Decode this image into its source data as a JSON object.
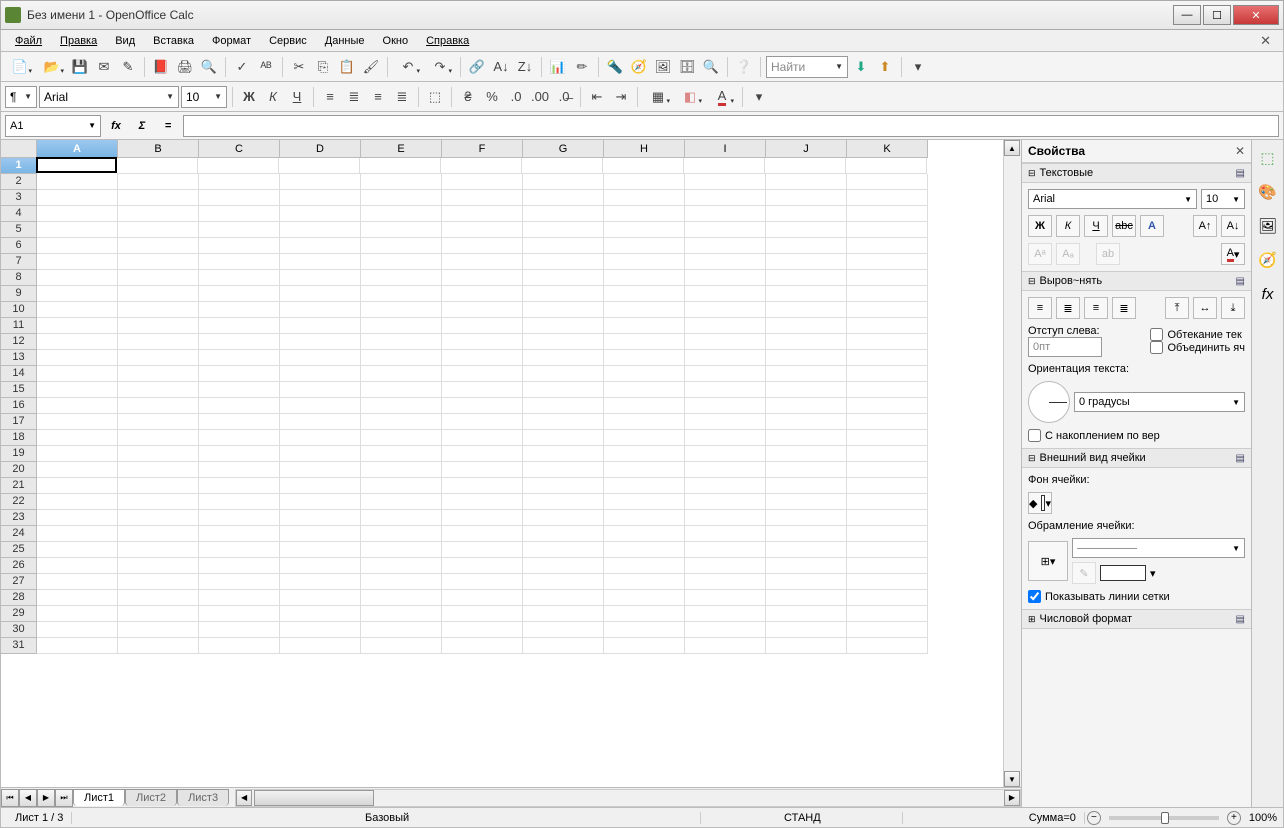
{
  "title": "Без имени 1 - OpenOffice Calc",
  "menu": [
    "Файл",
    "Правка",
    "Вид",
    "Вставка",
    "Формат",
    "Сервис",
    "Данные",
    "Окно",
    "Справка"
  ],
  "toolbar2": {
    "font": "Arial",
    "size": "10"
  },
  "find_placeholder": "Найти",
  "formulabar": {
    "ref": "A1",
    "fx": "fx",
    "sigma": "Σ",
    "eq": "="
  },
  "columns": [
    "A",
    "B",
    "C",
    "D",
    "E",
    "F",
    "G",
    "H",
    "I",
    "J",
    "K"
  ],
  "rowcount": 31,
  "tabs": [
    "Лист1",
    "Лист2",
    "Лист3"
  ],
  "sidebar": {
    "title": "Свойства",
    "sections": {
      "text": {
        "title": "Текстовые",
        "font": "Arial",
        "size": "10"
      },
      "align": {
        "title": "Выров~нять",
        "indent_label": "Отступ слева:",
        "indent_value": "0пт",
        "wrap": "Обтекание тек",
        "merge": "Объединить яч",
        "orient_label": "Ориентация текста:",
        "orient_value": "0 градусы",
        "stack": "С накоплением по вер"
      },
      "appearance": {
        "title": "Внешний вид ячейки",
        "bgLabel": "Фон ячейки:",
        "borderLabel": "Обрамление ячейки:",
        "gridlines": "Показывать линии сетки"
      },
      "number": {
        "title": "Числовой формат"
      }
    }
  },
  "status": {
    "sheet": "Лист 1 / 3",
    "style": "Базовый",
    "mode": "СТАНД",
    "sum": "Сумма=0",
    "zoom": "100%"
  }
}
